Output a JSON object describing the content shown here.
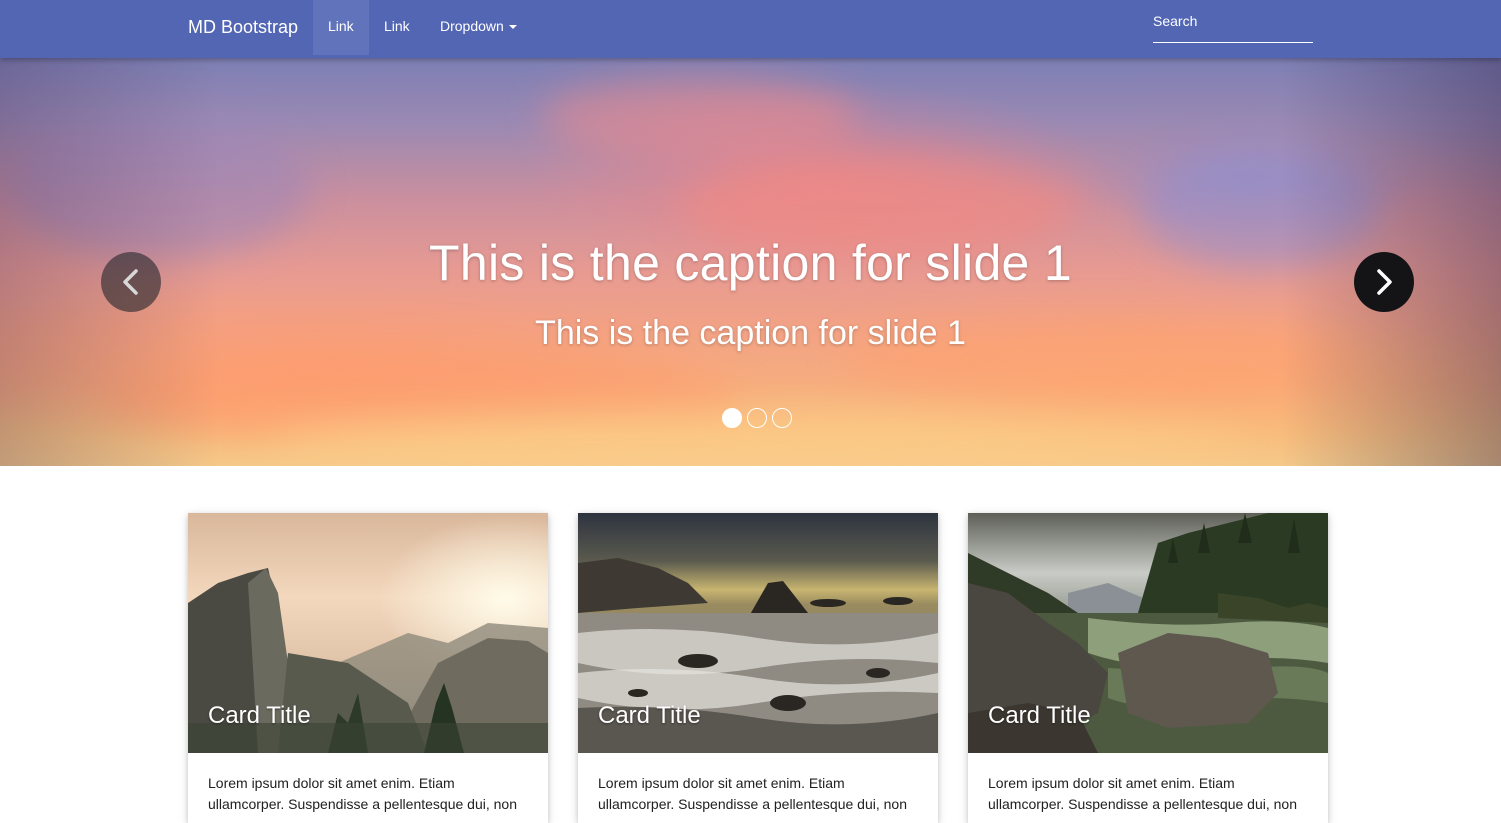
{
  "navbar": {
    "brand": "MD Bootstrap",
    "links": [
      {
        "label": "Link"
      },
      {
        "label": "Link"
      }
    ],
    "dropdown": {
      "label": "Dropdown"
    },
    "search": {
      "placeholder": "Search",
      "value": ""
    },
    "background_color": "#5266b4"
  },
  "carousel": {
    "slides": [
      {
        "title": "This is the caption for slide 1",
        "subtitle": "This is the caption for slide 1"
      }
    ],
    "indicator_count": 3,
    "active_index": 0,
    "controls": {
      "prev_icon": "chevron-left-icon",
      "next_icon": "chevron-right-icon"
    }
  },
  "cards": [
    {
      "title": "Card Title",
      "text": "Lorem ipsum dolor sit amet enim. Etiam ullamcorper. Suspendisse a pellentesque dui, non",
      "image": "mountain-valley-sunrise"
    },
    {
      "title": "Card Title",
      "text": "Lorem ipsum dolor sit amet enim. Etiam ullamcorper. Suspendisse a pellentesque dui, non",
      "image": "rocky-seashore"
    },
    {
      "title": "Card Title",
      "text": "Lorem ipsum dolor sit amet enim. Etiam ullamcorper. Suspendisse a pellentesque dui, non",
      "image": "forest-river-rocks"
    }
  ]
}
